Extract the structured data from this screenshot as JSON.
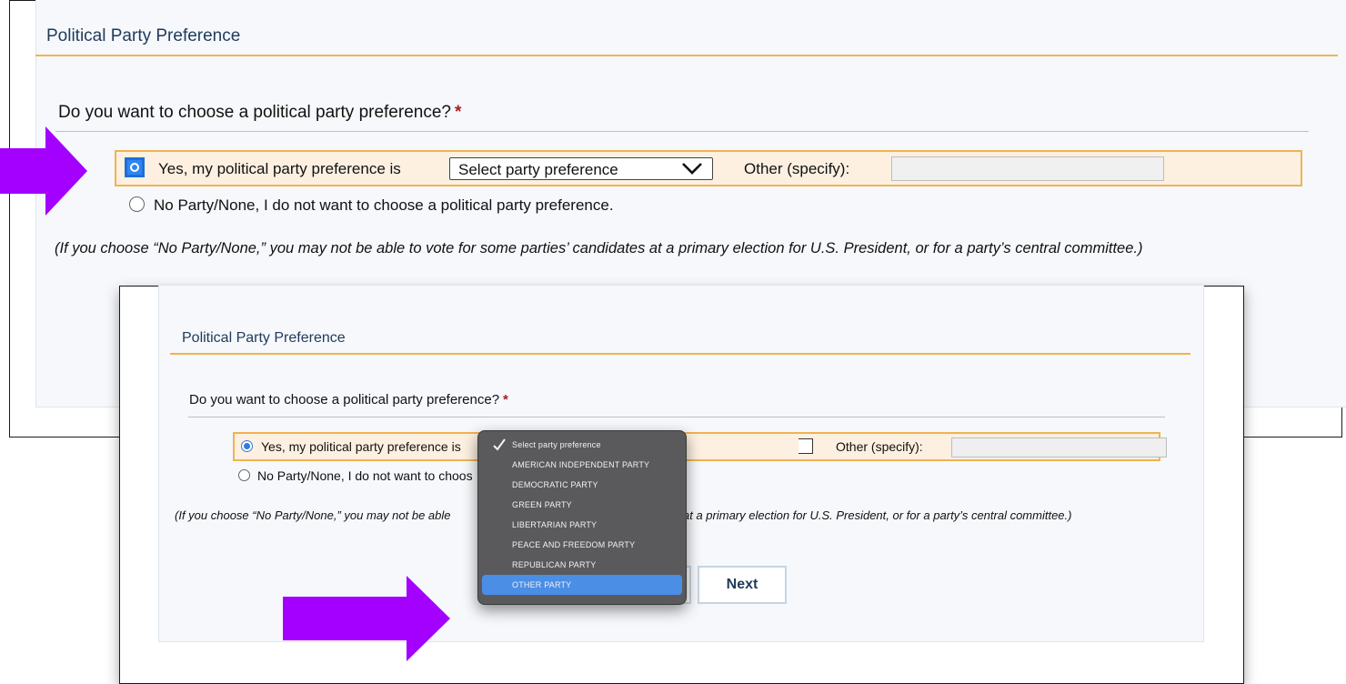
{
  "back_panel": {
    "title": "Political Party Preference",
    "question": "Do you want to choose a political party preference?",
    "required_mark": "*",
    "yes_label": "Yes, my political party preference is",
    "select_value": "Select party preference",
    "other_label": "Other (specify):",
    "other_value": "",
    "no_label": "No Party/None, I do not want to choose a political party preference.",
    "note": "(If you choose “No Party/None,” you may not be able to vote for some parties’ candidates at a primary election for U.S. President, or for a party’s central committee.)"
  },
  "front_panel": {
    "title": "Political Party Preference",
    "question": "Do you want to choose a political party preference?",
    "required_mark": "*",
    "yes_label": "Yes, my political party preference is",
    "other_label": "Other (specify):",
    "other_value": "",
    "no_label": "No Party/None, I do not want to choos",
    "note_left": "(If you choose “No Party/None,” you may not be able",
    "note_right": "at a primary election for U.S. President, or for a party’s central committee.)",
    "next_label": "Next"
  },
  "dropdown": {
    "options": [
      "Select party preference",
      "AMERICAN INDEPENDENT PARTY",
      "DEMOCRATIC PARTY",
      "GREEN PARTY",
      "LIBERTARIAN PARTY",
      "PEACE AND FREEDOM PARTY",
      "REPUBLICAN PARTY",
      "OTHER PARTY"
    ],
    "checked_option": "Select party preference",
    "highlighted_option": "OTHER PARTY"
  },
  "colors": {
    "accent_orange": "#f0b350",
    "arrow_purple": "#a300ff",
    "title_blue": "#1f3a5a",
    "required_red": "#a42025",
    "menu_highlight": "#4a8ee6"
  }
}
